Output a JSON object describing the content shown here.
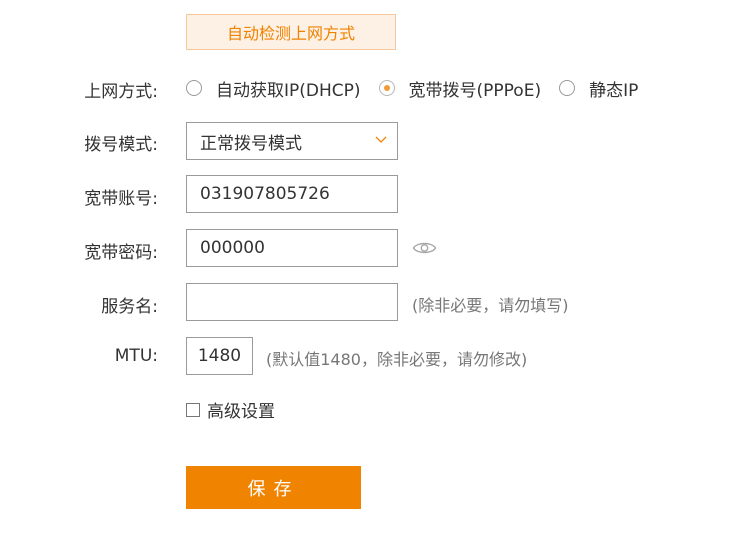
{
  "detect_button": {
    "label": "自动检测上网方式"
  },
  "connection_type": {
    "label": "上网方式:",
    "options": [
      {
        "label": "自动获取IP(DHCP)",
        "checked": false
      },
      {
        "label": "宽带拨号(PPPoE)",
        "checked": true
      },
      {
        "label": "静态IP",
        "checked": false
      }
    ]
  },
  "dial_mode": {
    "label": "拨号模式:",
    "value": "正常拨号模式"
  },
  "account": {
    "label": "宽带账号:",
    "value": "031907805726"
  },
  "password": {
    "label": "宽带密码:",
    "value": "000000"
  },
  "service_name": {
    "label": "服务名:",
    "value": "",
    "hint": "(除非必要，请勿填写)"
  },
  "mtu": {
    "label": "MTU:",
    "value": "1480",
    "hint": "(默认值1480，除非必要，请勿修改)"
  },
  "advanced": {
    "label": "高级设置",
    "checked": false
  },
  "save_button": {
    "label": "保存"
  },
  "colors": {
    "accent": "#f08300",
    "accent_light": "#fdf1e6",
    "radio_dot": "#f09a3a"
  }
}
